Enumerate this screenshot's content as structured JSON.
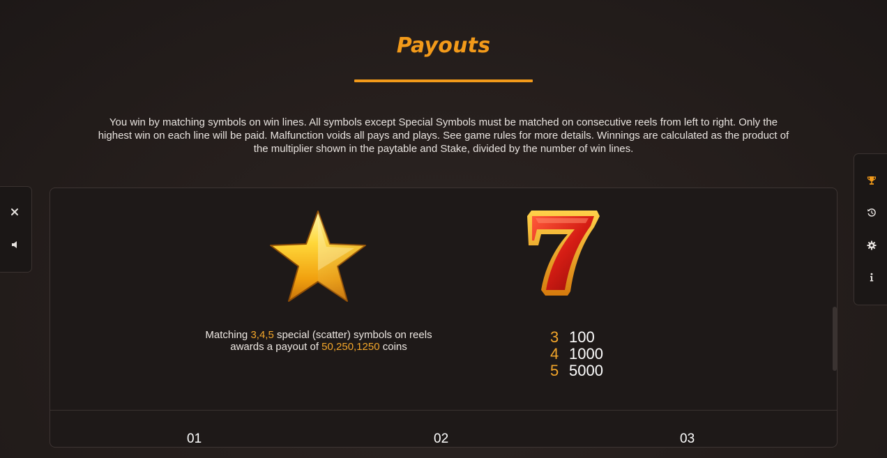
{
  "header": {
    "title": "Payouts"
  },
  "intro_text": "You win by matching symbols on win lines. All symbols except Special Symbols must be matched on consecutive reels from left to right. Only the highest win on each line will be paid. Malfunction voids all pays and plays. See game rules for more details. Winnings are calculated as the product of the multiplier shown in the paytable and Stake, divided by the number of win lines.",
  "left_controls": [
    {
      "icon": "close-icon"
    },
    {
      "icon": "sound-icon"
    }
  ],
  "right_controls": [
    {
      "icon": "trophy-icon",
      "active": true
    },
    {
      "icon": "history-icon"
    },
    {
      "icon": "gear-icon"
    },
    {
      "icon": "info-icon"
    }
  ],
  "scatter": {
    "symbol": "star-icon",
    "text_1": "Matching ",
    "counts": "3,4,5",
    "text_2": " special (scatter) symbols on reels awards a payout of ",
    "payouts": "50,250,1250",
    "text_3": " coins"
  },
  "seven": {
    "symbol": "seven-icon",
    "rows": [
      {
        "count": "3",
        "value": "100"
      },
      {
        "count": "4",
        "value": "1000"
      },
      {
        "count": "5",
        "value": "5000"
      }
    ]
  },
  "pages": [
    "01",
    "02",
    "03"
  ],
  "colors": {
    "accent": "#f29a1a",
    "highlight": "#f3a62a",
    "background": "#2a2220",
    "panel": "#1e1918"
  }
}
